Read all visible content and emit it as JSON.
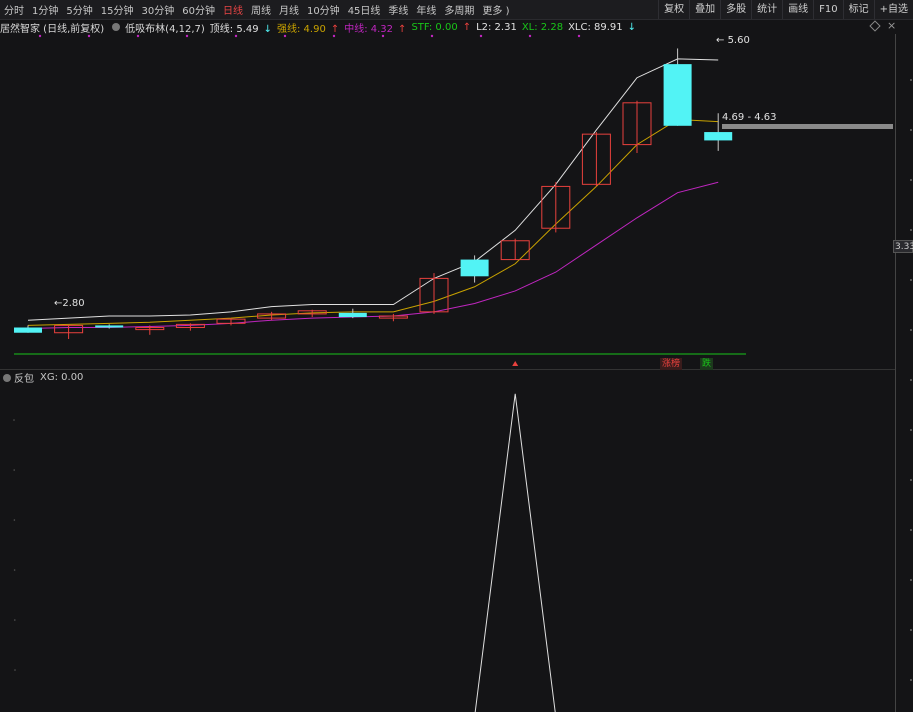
{
  "toolbar": {
    "periods": [
      "分时",
      "1分钟",
      "5分钟",
      "15分钟",
      "30分钟",
      "60分钟",
      "日线",
      "周线",
      "月线",
      "10分钟",
      "45日线",
      "季线",
      "年线",
      "多周期",
      "更多 )"
    ],
    "active_period": "日线",
    "right_buttons": [
      "复权",
      "叠加",
      "多股",
      "统计",
      "画线",
      "F10",
      "标记",
      "+自选"
    ]
  },
  "info": {
    "stock": "居然智家 (日线,前复权)",
    "indicator": "低吸布林(4,12,7)",
    "top_label": "顶线: 5.49",
    "top_arrow": "↓",
    "strong_label": "强线: 4.90",
    "strong_arrow": "↑",
    "mid_label": "中线: 4.32",
    "mid_arrow": "↑",
    "stf_label": "STF: 0.00",
    "stf_arrow": "↑",
    "l2_label": "L2: 2.31",
    "xl_label": "XL: 2.28",
    "xlc_label": "XLC: 89.91",
    "xlc_arrow": "↓"
  },
  "colors": {
    "up": "#e8413d",
    "down": "#52f3f5",
    "top_line": "#e0e0e0",
    "strong_line": "#c8a200",
    "mid_line": "#c026c0",
    "green_line": "#19c519",
    "stf": "#19c519",
    "grid_dot": "#c026c0"
  },
  "annotations": {
    "high_label": "5.60",
    "low_label": "←2.80",
    "range_label": "4.69 - 4.63",
    "axis_tag": "3.33",
    "zhangting": "涨榜",
    "die": "跌"
  },
  "lower_panel": {
    "title": "反包",
    "value": "XG: 0.00"
  },
  "chart_data": {
    "type": "candlestick",
    "ohlc": [
      [
        2.93,
        2.95,
        2.88,
        2.88
      ],
      [
        2.88,
        2.95,
        2.82,
        2.95
      ],
      [
        2.95,
        2.96,
        2.92,
        2.93
      ],
      [
        2.91,
        2.95,
        2.86,
        2.93
      ],
      [
        2.93,
        2.97,
        2.9,
        2.96
      ],
      [
        2.97,
        3.02,
        2.95,
        3.01
      ],
      [
        3.02,
        3.08,
        3.0,
        3.06
      ],
      [
        3.06,
        3.1,
        3.03,
        3.09
      ],
      [
        3.07,
        3.11,
        3.02,
        3.03
      ],
      [
        3.02,
        3.06,
        2.99,
        3.04
      ],
      [
        3.08,
        3.45,
        3.06,
        3.4
      ],
      [
        3.58,
        3.62,
        3.36,
        3.42
      ],
      [
        3.58,
        3.78,
        3.58,
        3.76
      ],
      [
        3.88,
        4.32,
        3.84,
        4.28
      ],
      [
        4.3,
        4.8,
        4.28,
        4.78
      ],
      [
        4.68,
        5.1,
        4.6,
        5.08
      ],
      [
        5.45,
        5.6,
        4.86,
        4.86
      ],
      [
        4.8,
        4.98,
        4.62,
        4.72
      ]
    ],
    "top_line": [
      3.0,
      3.02,
      3.04,
      3.04,
      3.05,
      3.08,
      3.13,
      3.15,
      3.15,
      3.15,
      3.4,
      3.56,
      3.86,
      4.3,
      4.82,
      5.32,
      5.5,
      5.49
    ],
    "strong_line": [
      2.95,
      2.96,
      2.97,
      2.98,
      3.0,
      3.02,
      3.05,
      3.07,
      3.08,
      3.08,
      3.18,
      3.32,
      3.54,
      3.92,
      4.28,
      4.68,
      4.92,
      4.9
    ],
    "mid_line": [
      2.92,
      2.93,
      2.93,
      2.94,
      2.95,
      2.97,
      3.0,
      3.02,
      3.03,
      3.04,
      3.08,
      3.16,
      3.28,
      3.46,
      3.72,
      3.98,
      4.22,
      4.32
    ],
    "xg_signal": [
      0,
      0,
      0,
      0,
      0,
      0,
      0,
      0,
      0,
      0,
      0,
      0,
      1,
      0,
      0,
      0,
      0,
      0
    ]
  }
}
